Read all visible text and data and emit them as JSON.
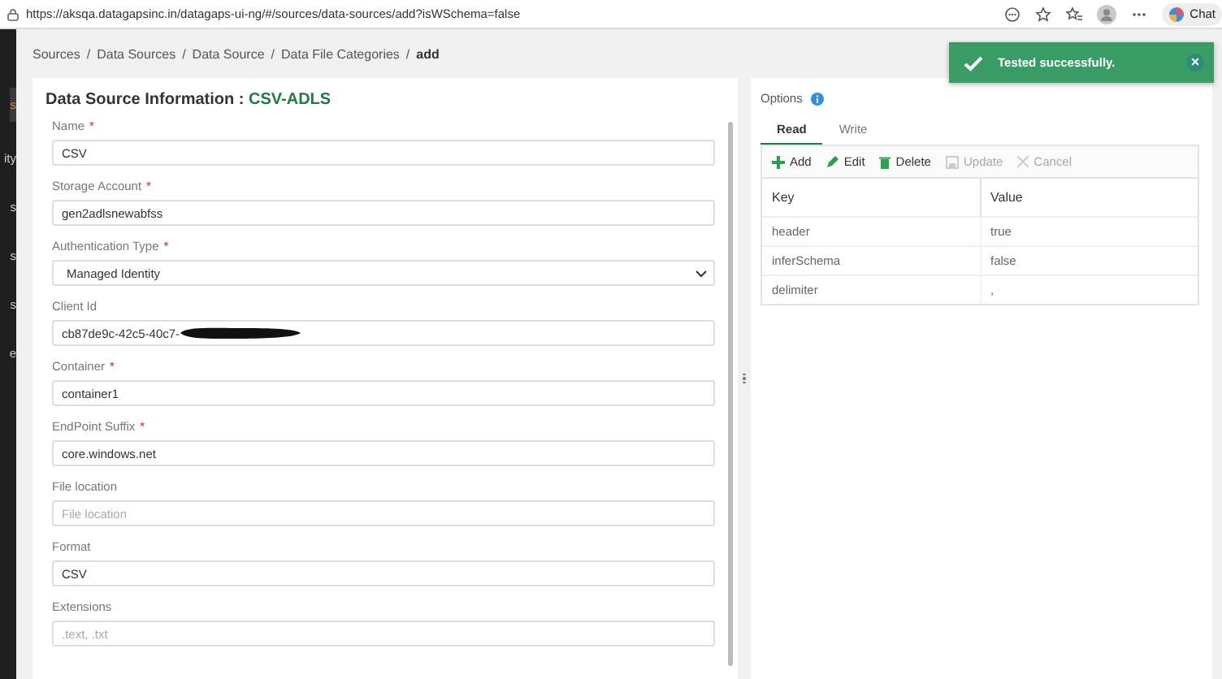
{
  "browser": {
    "url": "https://aksqa.datagapsinc.in/datagaps-ui-ng/#/sources/data-sources/add?isWSchema=false",
    "chat": "Chat"
  },
  "sidebar": {
    "items": [
      {
        "label": "s",
        "selected": true
      },
      {
        "label": "ity",
        "selected": false
      },
      {
        "label": "s",
        "selected": false
      },
      {
        "label": "s",
        "selected": false
      },
      {
        "label": "s",
        "selected": false
      },
      {
        "label": "e",
        "selected": false
      }
    ]
  },
  "breadcrumb": {
    "separator": "/",
    "items": [
      "Sources",
      "Data Sources",
      "Data Source",
      "Data File Categories",
      "add"
    ]
  },
  "toast": {
    "message": "Tested successfully.",
    "close": "×"
  },
  "form": {
    "title": "Data Source Information : ",
    "name": "CSV-ADLS",
    "required_mark": "*",
    "fields": [
      {
        "kind": "input",
        "label": "Name",
        "required": true,
        "value": "CSV"
      },
      {
        "kind": "input",
        "label": "Storage Account",
        "required": true,
        "value": "gen2adlsnewabfss"
      },
      {
        "kind": "select",
        "label": "Authentication Type",
        "required": true,
        "value": "Managed Identity"
      },
      {
        "kind": "redacted",
        "label": "Client Id",
        "required": false,
        "value": "cb87de9c-42c5-40c7-"
      },
      {
        "kind": "input",
        "label": "Container",
        "required": true,
        "value": "container1"
      },
      {
        "kind": "input",
        "label": "EndPoint Suffix",
        "required": true,
        "value": "core.windows.net"
      },
      {
        "kind": "input",
        "label": "File location",
        "required": false,
        "placeholder": "File location"
      },
      {
        "kind": "input",
        "label": "Format",
        "required": false,
        "value": "CSV"
      },
      {
        "kind": "input",
        "label": "Extensions",
        "required": false,
        "placeholder": ".text, .txt"
      }
    ]
  },
  "options": {
    "title": "Options",
    "tabs": [
      {
        "label": "Read",
        "selected": true
      },
      {
        "label": "Write",
        "selected": false
      }
    ],
    "toolbar": [
      {
        "kind": "add",
        "label": "Add",
        "disabled": false
      },
      {
        "kind": "edit",
        "label": "Edit",
        "disabled": false
      },
      {
        "kind": "delete",
        "label": "Delete",
        "disabled": false
      },
      {
        "kind": "update",
        "label": "Update",
        "disabled": true
      },
      {
        "kind": "cancel",
        "label": "Cancel",
        "disabled": true
      }
    ],
    "columns": [
      "Key",
      "Value"
    ],
    "rows": [
      [
        "header",
        "true"
      ],
      [
        "inferSchema",
        "false"
      ],
      [
        "delimiter",
        ","
      ]
    ]
  }
}
